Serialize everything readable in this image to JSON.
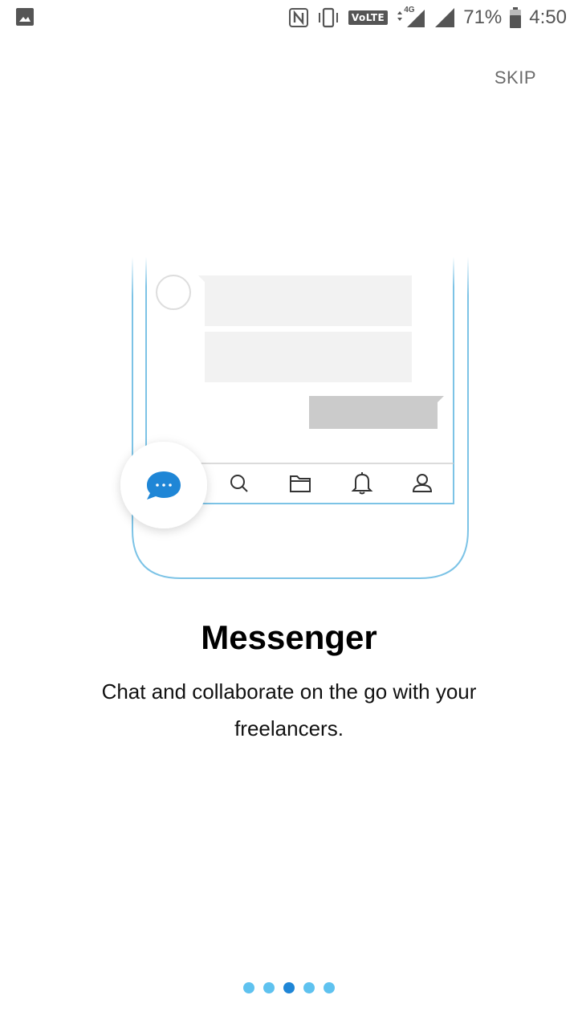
{
  "status_bar": {
    "battery_percent": "71%",
    "time": "4:50",
    "volte_label": "VoLTE",
    "network_label": "4G"
  },
  "skip_label": "SKIP",
  "onboarding": {
    "title": "Messenger",
    "subtitle": "Chat and collaborate on the go with your freelancers.",
    "total_pages": 5,
    "current_page": 3
  },
  "colors": {
    "accent": "#1f86d6",
    "dot_inactive": "#5fc2ef",
    "phone_outline": "#7cc3e6"
  },
  "illustration_icons": [
    "chat-bubble-icon",
    "search-icon",
    "folder-icon",
    "bell-icon",
    "user-icon"
  ]
}
